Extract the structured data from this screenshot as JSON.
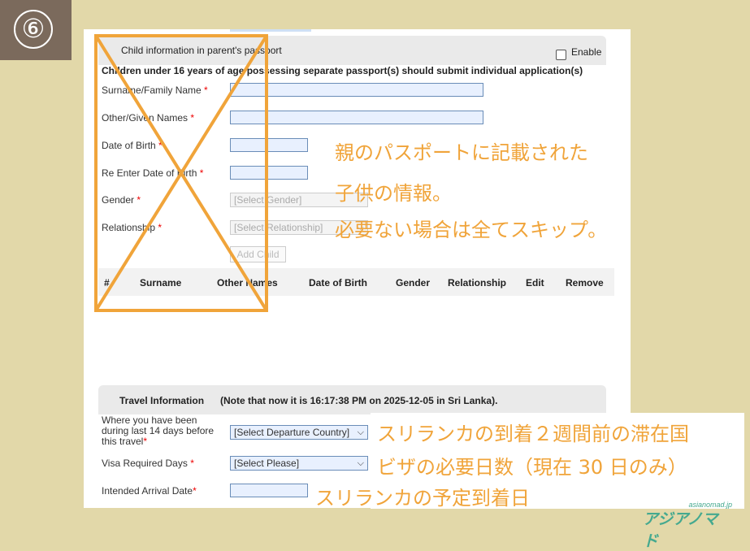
{
  "step": {
    "number": "⑥"
  },
  "child_section": {
    "title": "Child information in parent's passport",
    "enable_label": "Enable",
    "enable_checked": false,
    "notice": "Children under 16 years of age possessing separate passport(s) should submit individual application(s)",
    "fields": {
      "surname": {
        "label": "Surname/Family Name",
        "required": "*"
      },
      "other_names": {
        "label": "Other/Given Names",
        "required": "*"
      },
      "dob": {
        "label": "Date of Birth",
        "required": "*"
      },
      "re_dob": {
        "label": "Re Enter Date of Birth",
        "required": "*"
      },
      "gender": {
        "label": "Gender",
        "required": "*",
        "selected": "[Select Gender]"
      },
      "relationship": {
        "label": "Relationship",
        "required": "*",
        "selected": "[Select Relationship]"
      }
    },
    "add_button": "Add Child",
    "table_headers": [
      "#",
      "Surname",
      "Other Names",
      "Date of Birth",
      "Gender",
      "Relationship",
      "Edit",
      "Remove"
    ]
  },
  "travel_section": {
    "title": "Travel Information",
    "note": "(Note that now it is 16:17:38 PM on 2025-12-05 in Sri Lanka).",
    "fields": {
      "last14_line1": "Where you have been",
      "last14_line2": "during last 14 days before",
      "last14_line3": "this travel",
      "last14_required": "*",
      "last14_selected": "[Select Departure Country]",
      "visa_days_label": "Visa Required Days",
      "visa_days_required": "*",
      "visa_days_selected": "[Select Please]",
      "arrival_label": "Intended Arrival Date",
      "arrival_required": "*"
    }
  },
  "annotations": {
    "child_note_1": "親のパスポートに記載された",
    "child_note_2": "子供の情報。",
    "child_note_3": "必要ない場合は全てスキップ。",
    "last14_note": "スリランカの到着２週間前の滞在国",
    "visa_days_note": "ビザの必要日数（現在 30 日のみ）",
    "arrival_note": "スリランカの予定到着日"
  },
  "logo": {
    "small": "asianomad.jp",
    "big": "アジアノマド"
  },
  "colors": {
    "overlay": "#f0a43a",
    "background": "#e2d8a9",
    "badge": "#7b6a5c",
    "required": "#ee0000"
  }
}
